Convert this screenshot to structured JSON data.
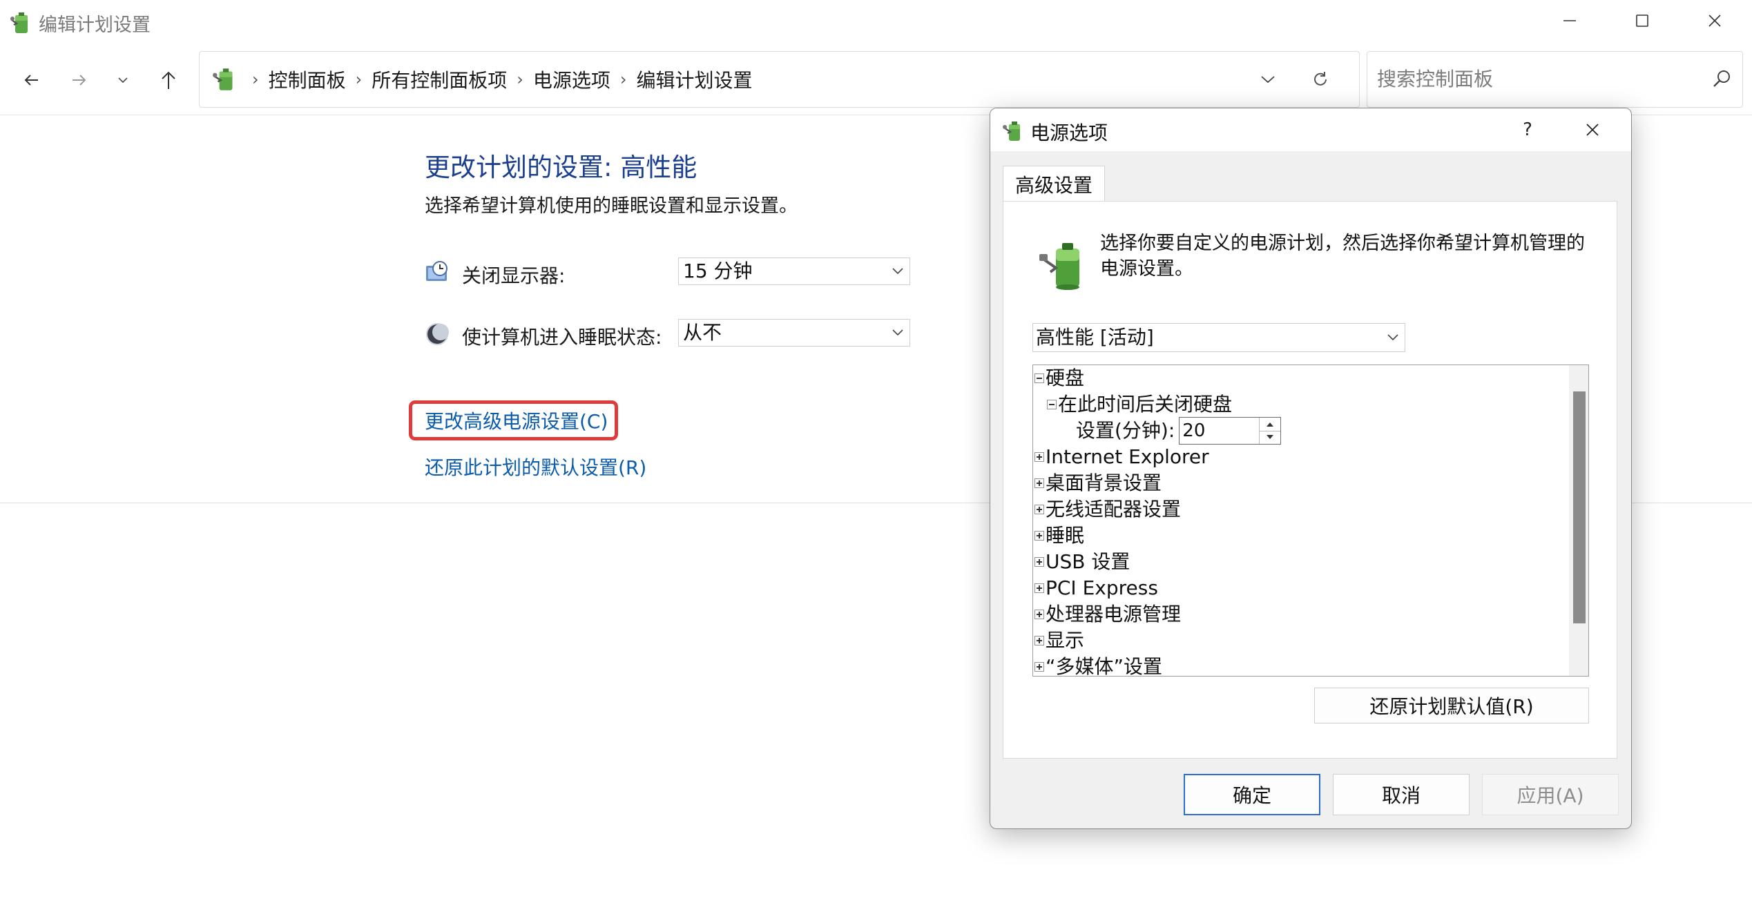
{
  "window": {
    "title": "编辑计划设置",
    "minimize_label": "minimize",
    "maximize_label": "maximize",
    "close_label": "close"
  },
  "navigation": {
    "breadcrumbs": [
      "控制面板",
      "所有控制面板项",
      "电源选项",
      "编辑计划设置"
    ],
    "search_placeholder": "搜索控制面板"
  },
  "main": {
    "title": "更改计划的设置: 高性能",
    "subtitle": "选择希望计算机使用的睡眠设置和显示设置。",
    "display_off_label": "关闭显示器:",
    "display_off_value": "15 分钟",
    "sleep_label": "使计算机进入睡眠状态:",
    "sleep_value": "从不",
    "advanced_link": "更改高级电源设置(C)",
    "restore_link": "还原此计划的默认设置(R)",
    "highlight_color": "#e03b3b"
  },
  "dialog": {
    "title": "电源选项",
    "help_label": "?",
    "tab_label": "高级设置",
    "description": "选择你要自定义的电源计划，然后选择你希望计算机管理的电源设置。",
    "plan_value": "高性能 [活动]",
    "tree": [
      {
        "label": "硬盘",
        "toggle": "minus",
        "level": 0
      },
      {
        "label": "在此时间后关闭硬盘",
        "toggle": "minus",
        "level": 1
      },
      {
        "label": "设置(分钟):",
        "toggle": "none",
        "level": 2,
        "spin_value": "20"
      },
      {
        "label": "Internet Explorer",
        "toggle": "plus",
        "level": 0
      },
      {
        "label": "桌面背景设置",
        "toggle": "plus",
        "level": 0
      },
      {
        "label": "无线适配器设置",
        "toggle": "plus",
        "level": 0
      },
      {
        "label": "睡眠",
        "toggle": "plus",
        "level": 0
      },
      {
        "label": "USB 设置",
        "toggle": "plus",
        "level": 0
      },
      {
        "label": "PCI Express",
        "toggle": "plus",
        "level": 0
      },
      {
        "label": "处理器电源管理",
        "toggle": "plus",
        "level": 0
      },
      {
        "label": "显示",
        "toggle": "plus",
        "level": 0
      },
      {
        "label": "“多媒体”设置",
        "toggle": "plus",
        "level": 0
      }
    ],
    "restore_defaults_button": "还原计划默认值(R)",
    "ok_button": "确定",
    "cancel_button": "取消",
    "apply_button": "应用(A)"
  }
}
